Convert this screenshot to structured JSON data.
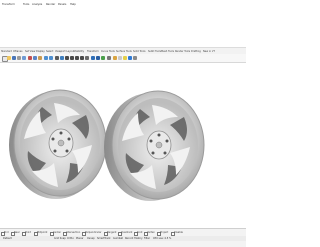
{
  "menu": {
    "items": [
      "Transform",
      "Tools",
      "Analyze",
      "Render",
      "Panels",
      "Help"
    ]
  },
  "toolbar_tabs": [
    "Standard",
    "CPlanes",
    "Set View",
    "Display",
    "Select",
    "Viewport Layout",
    "Visibility",
    "Transform",
    "Curve Tools",
    "Surface Tools",
    "Solid Tools",
    "SubD Tools",
    "Mesh Tools",
    "Render Tools",
    "Drafting",
    "New in V7"
  ],
  "toolbar_icons": [
    "new-icon",
    "open-icon",
    "save-icon",
    "print-icon",
    "import-icon",
    "cut-icon",
    "copy-icon",
    "paste-icon",
    "undo-icon",
    "redo-icon",
    "pan-icon",
    "rotate-view-icon",
    "zoom-icon",
    "zoom-window-icon",
    "zoom-extents-icon",
    "zoom-selected-icon",
    "undo-view-icon",
    "four-view-icon",
    "shaded-icon",
    "rendered-icon",
    "select-icon",
    "layer-icon",
    "properties-icon",
    "lights-icon",
    "render-icon",
    "options-icon"
  ],
  "osnaps": [
    "End",
    "Near",
    "Point",
    "Midpoint",
    "Center",
    "Intersection",
    "Perpendicular",
    "Tangent",
    "Quadrant",
    "Knot",
    "Vertex",
    "Project",
    "Disable"
  ],
  "status": {
    "items": [
      "Default",
      "Grid Snap",
      "Ortho",
      "Planar",
      "Osnap",
      "SmartTrack",
      "Gumball",
      "Record History",
      "Filter",
      "CPU use: 4.5 %"
    ]
  },
  "colors": {
    "wheel_light": "#d6d6d6",
    "wheel_mid": "#aeaeae",
    "wheel_dark": "#7a7a7a",
    "background": "#ffffff",
    "statusbar": "#f3f3f3"
  }
}
